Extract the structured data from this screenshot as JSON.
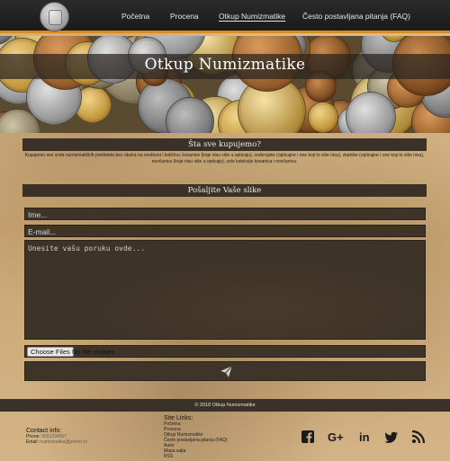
{
  "nav": {
    "items": [
      {
        "label": "Početna"
      },
      {
        "label": "Procena"
      },
      {
        "label": "Otkup Numizmatike"
      },
      {
        "label": "Često postavljana pitanja (FAQ)"
      }
    ]
  },
  "banner": {
    "title": "Otkup Numizmatike"
  },
  "intro": {
    "heading": "Šta sve kupujemo?",
    "text": "Kupujemo sve vrste numizmatičkih predmeta bez obzira na vrednost i količinu: kovanice (koje nisu više u opticaju), srebrnjake (opticajne i one koji to više nisu), zlatnike (opticajne i one koji to više nisu), novčanice (koje nisu više u opticaju), cele kolekcije kovanica i novčanica."
  },
  "form": {
    "heading": "Pošaljite Vaše slike",
    "name_placeholder": "Ime...",
    "email_placeholder": "E-mail...",
    "message_placeholder": "Unesite vašu poruku ovde...",
    "file_button": "Choose Files",
    "file_status": "No file chosen"
  },
  "footer": {
    "copyright": "© 2018 Otkup Numizmatike",
    "contact_heading": "Contact info:",
    "phone_label": "Phone:",
    "phone_value": "0691234567",
    "email_label": "Email:",
    "email_value": "numizmatika@primer.rs",
    "links_heading": "Site Links:",
    "links": [
      "Početna",
      "Procena",
      "Otkup Numizmatike",
      "Često postavljana pitanja (FAQ)",
      "Autor",
      "Mapa sajta",
      "RSS"
    ]
  },
  "social_icons": [
    "facebook-icon",
    "google-plus-icon",
    "linkedin-icon",
    "twitter-icon",
    "rss-icon"
  ],
  "colors": {
    "accent": "#e08a1e",
    "dark_panel": "#3b3129",
    "header": "#1f1f1f"
  }
}
